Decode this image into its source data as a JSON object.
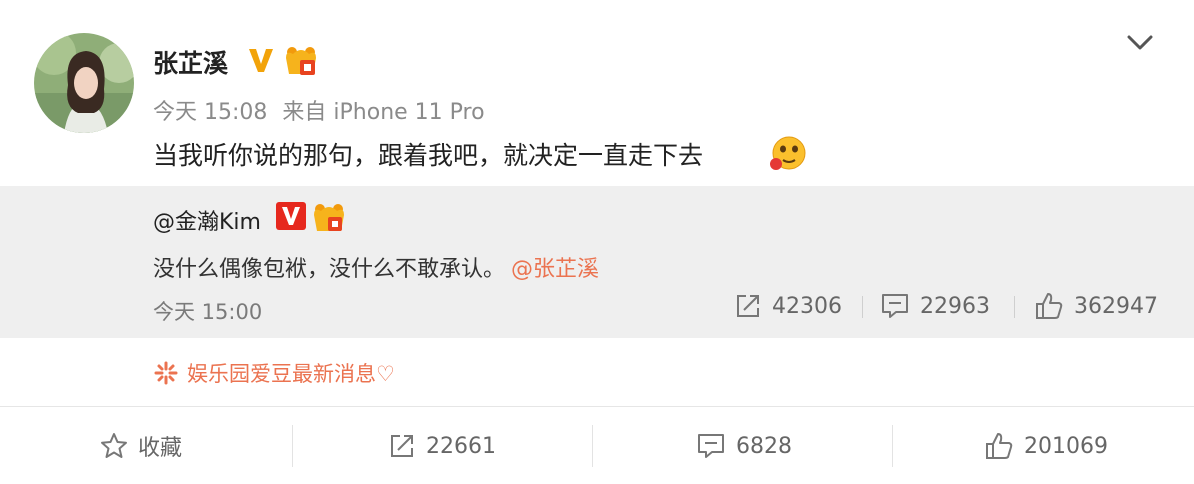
{
  "post": {
    "author": "张芷溪",
    "time": "今天 15:08",
    "source_prefix": "来自",
    "source_device": "iPhone 11 Pro",
    "text": "当我听你说的那句，跟着我吧，就决定一直走下去"
  },
  "repost": {
    "author": "@金瀚Kim",
    "text": "没什么偶像包袱，没什么不敢承认。",
    "mention": "@张芷溪",
    "time": "今天 15:00",
    "stats": {
      "forward": "42306",
      "comment": "22963",
      "like": "362947"
    }
  },
  "source_topic": "娱乐园爱豆最新消息♡",
  "toolbar": {
    "favorite_label": "收藏",
    "forward_count": "22661",
    "comment_count": "6828",
    "like_count": "201069"
  },
  "colors": {
    "link_orange": "#eb7350",
    "verified_gold": "#f2a30a",
    "verified_red": "#e6281e",
    "repost_bg": "#efefef"
  },
  "icons": [
    "chevron-down-icon",
    "verified-icon",
    "crown-badge-icon",
    "face-emoji-icon",
    "forward-icon",
    "comment-icon",
    "like-icon",
    "star-icon",
    "topic-icon"
  ]
}
